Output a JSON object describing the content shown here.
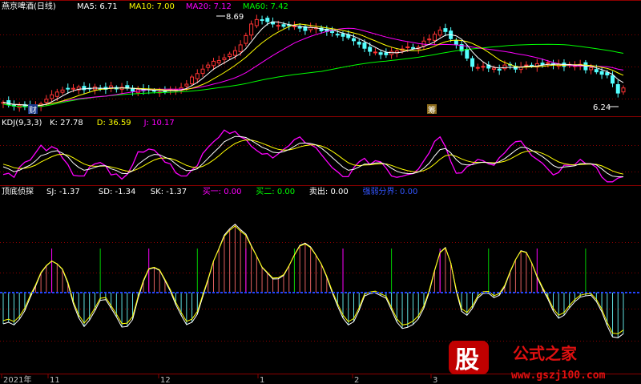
{
  "header": {
    "title": "燕京啤酒(日线)",
    "ma": [
      {
        "label": "MA5:",
        "value": "6.71",
        "color": "#ffffff"
      },
      {
        "label": "MA10:",
        "value": "7.00",
        "color": "#ffff00"
      },
      {
        "label": "MA20:",
        "value": "7.12",
        "color": "#ff00ff"
      },
      {
        "label": "MA60:",
        "value": "7.42",
        "color": "#00ff00"
      }
    ]
  },
  "kdj": {
    "name": "KDJ(9,3,3)",
    "items": [
      {
        "label": "K:",
        "value": "27.78",
        "color": "#ffffff"
      },
      {
        "label": "D:",
        "value": "36.59",
        "color": "#ffff00"
      },
      {
        "label": "J:",
        "value": "10.17",
        "color": "#ff00ff"
      }
    ]
  },
  "ind": {
    "name": "顶底侦探",
    "items": [
      {
        "label": "SJ:",
        "value": "-1.37",
        "color": "#ffffff"
      },
      {
        "label": "SD:",
        "value": "-1.34",
        "color": "#ffffff"
      },
      {
        "label": "SK:",
        "value": "-1.37",
        "color": "#ffffff"
      },
      {
        "label": "买一:",
        "value": "0.00",
        "color": "#ff00ff"
      },
      {
        "label": "买二:",
        "value": "0.00",
        "color": "#00ff00"
      },
      {
        "label": "卖出:",
        "value": "0.00",
        "color": "#ffffff"
      },
      {
        "label": "强弱分界:",
        "value": "0.00",
        "color": "#3355ff"
      }
    ]
  },
  "markers": {
    "high": "8.69",
    "low": "6.24",
    "cai": "财",
    "chou": "筹"
  },
  "xaxis": [
    "2021年",
    "11",
    "12",
    "1",
    "2",
    "3"
  ],
  "watermark": {
    "logo": "股",
    "text": "公式之家",
    "url": "www.gszj100.com"
  },
  "colors": {
    "up": "#ff3333",
    "down": "#54ffff",
    "ma5": "#ffffff",
    "ma10": "#ffff00",
    "ma20": "#ff00ff",
    "ma60": "#00ff00",
    "grid": "#8b0000"
  },
  "chart_data": {
    "type": "line",
    "price_close": [
      6.24,
      6.17,
      6.13,
      6.15,
      6.11,
      6.14,
      6.15,
      6.2,
      6.33,
      6.46,
      6.54,
      6.6,
      6.63,
      6.65,
      6.69,
      6.61,
      6.64,
      6.69,
      6.64,
      6.62,
      6.72,
      6.63,
      6.68,
      6.65,
      6.57,
      6.62,
      6.58,
      6.61,
      6.58,
      6.54,
      6.56,
      6.62,
      6.61,
      6.67,
      6.77,
      6.98,
      7.08,
      7.21,
      7.33,
      7.44,
      7.46,
      7.54,
      7.65,
      7.75,
      7.92,
      8.19,
      8.53,
      8.66,
      8.65,
      8.6,
      8.53,
      8.49,
      8.46,
      8.49,
      8.47,
      8.41,
      8.34,
      8.44,
      8.42,
      8.33,
      8.31,
      8.28,
      8.23,
      8.17,
      8.13,
      8.04,
      7.94,
      7.82,
      7.73,
      7.71,
      7.64,
      7.63,
      7.73,
      7.74,
      7.8,
      7.86,
      7.84,
      7.85,
      8.03,
      8.09,
      8.23,
      8.35,
      8.31,
      8.1,
      7.93,
      7.74,
      7.53,
      7.29,
      7.26,
      7.29,
      7.24,
      7.24,
      7.18,
      7.33,
      7.34,
      7.21,
      7.28,
      7.33,
      7.32,
      7.37,
      7.34,
      7.4,
      7.33,
      7.35,
      7.29,
      7.35,
      7.31,
      7.35,
      7.19,
      7.25,
      7.13,
      7.06,
      7.04,
      6.8,
      6.51,
      6.66
    ],
    "kdj_j": [
      16,
      20,
      8,
      37,
      52,
      58,
      79,
      101,
      85,
      97,
      90,
      64,
      45,
      14,
      12,
      12,
      38,
      47,
      51,
      41,
      15,
      18,
      3,
      17,
      44,
      82,
      81,
      90,
      87,
      71,
      52,
      47,
      21,
      12,
      12,
      30,
      42,
      77,
      95,
      111,
      124,
      145,
      135,
      141,
      125,
      118,
      98,
      86,
      75,
      77,
      64,
      76,
      89,
      100,
      117,
      125,
      108,
      103,
      94,
      74,
      55,
      36,
      24,
      10,
      10,
      36,
      53,
      63,
      45,
      56,
      53,
      35,
      12,
      8,
      11,
      16,
      19,
      32,
      56,
      79,
      112,
      125,
      97,
      54,
      20,
      21,
      39,
      46,
      60,
      56,
      47,
      43,
      65,
      79,
      98,
      111,
      113,
      92,
      71,
      60,
      49,
      32,
      15,
      22,
      43,
      43,
      45,
      60,
      48,
      47,
      37,
      9,
      -5,
      -5,
      6,
      10
    ],
    "xaxis_labels": [
      "2021年",
      "11",
      "12",
      "1",
      "2",
      "3"
    ]
  }
}
